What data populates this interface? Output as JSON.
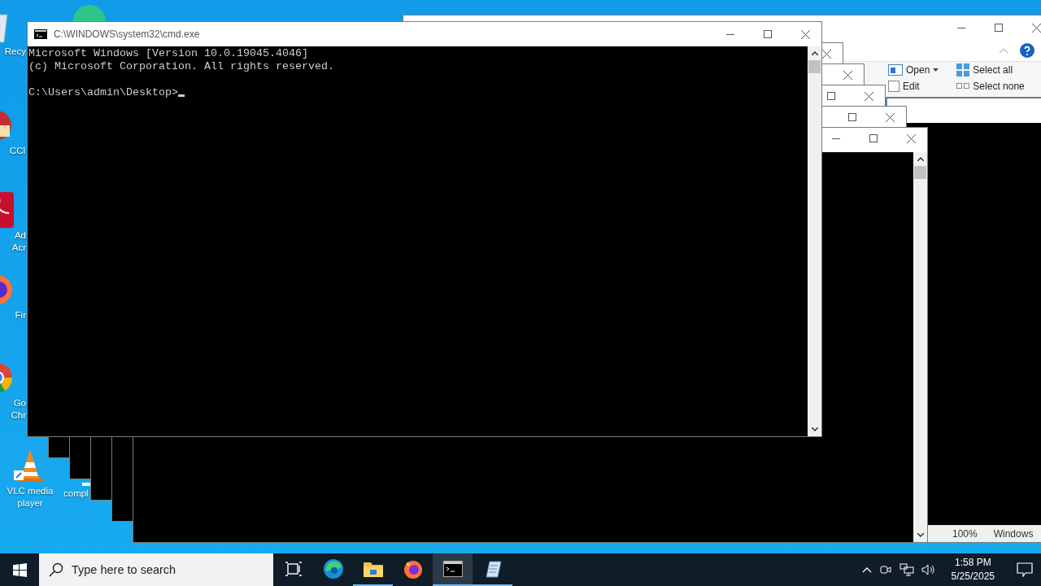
{
  "desktop_icons": [
    {
      "kind": "recycle",
      "lines": [
        "Recy"
      ]
    },
    {
      "kind": "ccleaner",
      "lines": [
        "CCl"
      ]
    },
    {
      "kind": "acrobat",
      "lines": [
        "Ad",
        "Acr"
      ]
    },
    {
      "kind": "firefox",
      "lines": [
        "Fir"
      ]
    },
    {
      "kind": "chrome",
      "lines": [
        "Go",
        "Chr"
      ]
    },
    {
      "kind": "vlc",
      "lines": [
        "VLC media",
        "player"
      ]
    },
    {
      "kind": "file",
      "lines": [
        "compl"
      ]
    }
  ],
  "explorer": {
    "ribbon": [
      {
        "kind": "open",
        "label": "Open"
      },
      {
        "kind": "edit",
        "label": "Edit"
      },
      {
        "kind": "selectall",
        "label": "Select all"
      },
      {
        "kind": "selectnone",
        "label": "Select none"
      }
    ]
  },
  "right_window": {
    "status": [
      "100%",
      "Windows"
    ]
  },
  "stacked_windows": [
    {
      "kind": "console"
    },
    {
      "kind": "console"
    },
    {
      "kind": "console"
    },
    {
      "kind": "console"
    },
    {
      "kind": "console"
    }
  ],
  "cmd": {
    "title": "C:\\WINDOWS\\system32\\cmd.exe",
    "lines": [
      "Microsoft Windows [Version 10.0.19045.4046]",
      "(c) Microsoft Corporation. All rights reserved."
    ],
    "prompt": "C:\\Users\\admin\\Desktop>"
  },
  "taskbar": {
    "search": {
      "placeholder": "Type here to search"
    },
    "apps": [
      {
        "kind": "edge",
        "running": false,
        "selected": false
      },
      {
        "kind": "explorer",
        "running": true,
        "selected": false
      },
      {
        "kind": "firefox",
        "running": false,
        "selected": false
      },
      {
        "kind": "cmd",
        "running": true,
        "selected": true
      },
      {
        "kind": "notepad",
        "running": true,
        "selected": false
      }
    ],
    "time": "1:58 PM",
    "date": "5/25/2025"
  }
}
